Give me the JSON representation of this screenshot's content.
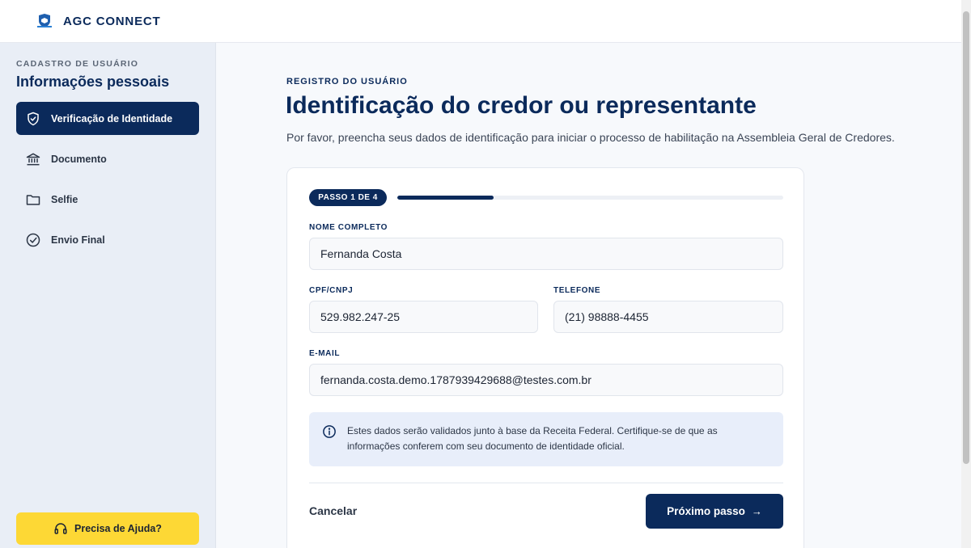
{
  "header": {
    "brand": "AGC CONNECT"
  },
  "sidebar": {
    "eyebrow": "CADASTRO DE USUÁRIO",
    "title": "Informações pessoais",
    "items": [
      {
        "label": "Verificação de Identidade",
        "icon": "shield-check-icon",
        "active": true
      },
      {
        "label": "Documento",
        "icon": "bank-icon",
        "active": false
      },
      {
        "label": "Selfie",
        "icon": "folder-icon",
        "active": false
      },
      {
        "label": "Envio Final",
        "icon": "check-circle-icon",
        "active": false
      }
    ],
    "help_label": "Precisa de Ajuda?"
  },
  "main": {
    "eyebrow": "REGISTRO DO USUÁRIO",
    "title": "Identificação do credor ou representante",
    "description": "Por favor, preencha seus dados de identificação para iniciar o processo de habilitação na Assembleia Geral de Credores."
  },
  "form": {
    "step_label": "PASSO 1 DE 4",
    "progress": 0.25,
    "name_label": "NOME COMPLETO",
    "name_value": "Fernanda Costa",
    "cpf_label": "CPF/CNPJ",
    "cpf_value": "529.982.247-25",
    "phone_label": "TELEFONE",
    "phone_value": "(21) 98888-4455",
    "email_label": "E-MAIL",
    "email_value": "fernanda.costa.demo.1787939429688@testes.com.br",
    "info_text": "Estes dados serão validados junto à base da Receita Federal. Certifique-se de que as informações conferem com seu documento de identidade oficial.",
    "cancel_label": "Cancelar",
    "next_label": "Próximo passo",
    "next_arrow": "→"
  },
  "colors": {
    "primary": "#0b2a5b",
    "accent": "#fdd835",
    "info_bg": "#e8eefa"
  }
}
